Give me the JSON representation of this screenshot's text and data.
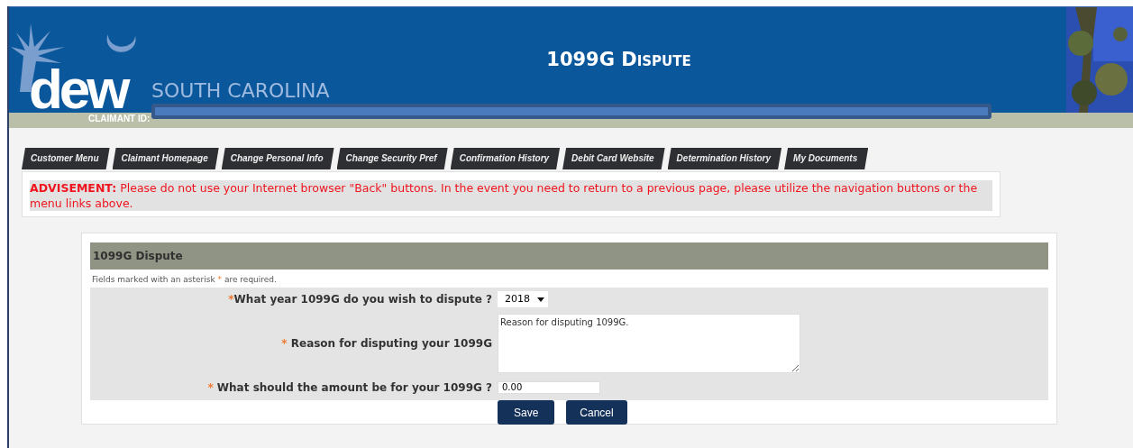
{
  "header": {
    "title": "1099G Dispute",
    "logo_text": "dew",
    "state_text": "SOUTH CAROLINA",
    "claimant_label": "CLAIMANT ID:"
  },
  "tabs": [
    {
      "label": "Customer Menu"
    },
    {
      "label": "Claimant Homepage"
    },
    {
      "label": "Change Personal Info"
    },
    {
      "label": "Change Security Pref"
    },
    {
      "label": "Confirmation History"
    },
    {
      "label": "Debit Card Website"
    },
    {
      "label": "Determination History"
    },
    {
      "label": "My Documents"
    }
  ],
  "advisement": {
    "text": "**ADVISEMENT:** Please do not use your Internet browser \"Back\" buttons. In the event you need to return to a previous page, please utilize the navigation buttons or the menu links above."
  },
  "form": {
    "title": "1099G Dispute",
    "note_before": "Fields marked with an asterisk",
    "note_mark": "*",
    "note_after": "are required.",
    "fields": [
      {
        "kind": "select",
        "required_mark": "*",
        "label": "What year 1099G do you wish to dispute ?",
        "value": "2018"
      },
      {
        "kind": "textarea",
        "required_mark": "*",
        "label": "Reason for disputing your 1099G",
        "value": "Reason for disputing 1099G."
      },
      {
        "kind": "text",
        "required_mark": "*",
        "label": "What should the amount be for your 1099G ?",
        "value": "0.00"
      }
    ],
    "buttons": [
      "Save",
      "Cancel"
    ]
  }
}
